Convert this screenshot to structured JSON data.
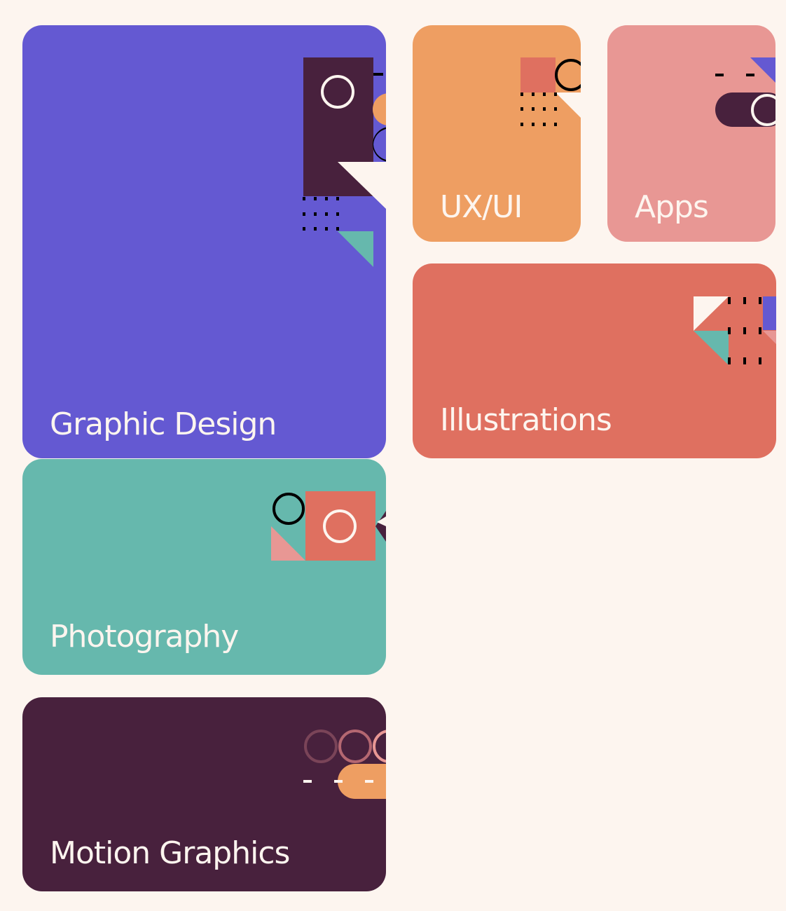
{
  "colors": {
    "background": "#fdf5ef",
    "purple": "#6459d2",
    "orange": "#ee9e62",
    "pink": "#e89794",
    "coral": "#df7060",
    "teal": "#66b8ad",
    "plum": "#48213d",
    "text": "#fdf5ef"
  },
  "categories": [
    {
      "id": "graphic-design",
      "label": "Graphic Design"
    },
    {
      "id": "ux-ui",
      "label": "UX/UI"
    },
    {
      "id": "apps",
      "label": "Apps"
    },
    {
      "id": "illustrations",
      "label": "Illustrations"
    },
    {
      "id": "photography",
      "label": "Photography"
    },
    {
      "id": "motion-graphics",
      "label": "Motion Graphics"
    }
  ]
}
